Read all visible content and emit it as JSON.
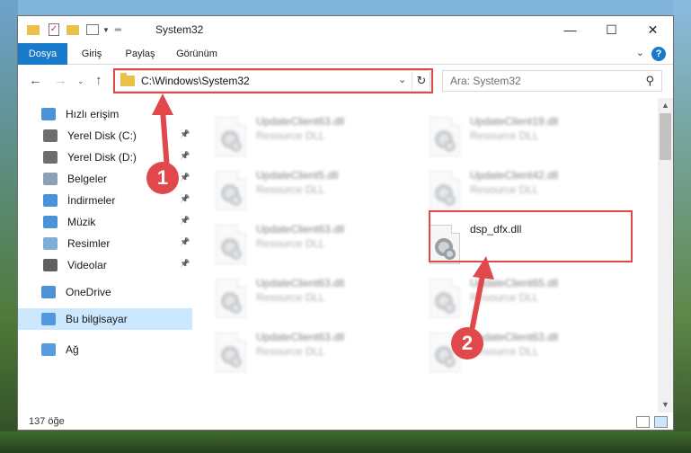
{
  "window": {
    "title": "System32"
  },
  "ribbon": {
    "tabs": [
      "Dosya",
      "Giriş",
      "Paylaş",
      "Görünüm"
    ],
    "help": "?"
  },
  "address": {
    "path": "C:\\Windows\\System32"
  },
  "search": {
    "placeholder": "Ara: System32"
  },
  "sidebar": {
    "items": [
      {
        "label": "Hızlı erişim",
        "icon": "star-icon",
        "pinned": false
      },
      {
        "label": "Yerel Disk (C:)",
        "icon": "drive-icon",
        "pinned": true
      },
      {
        "label": "Yerel Disk (D:)",
        "icon": "drive-icon",
        "pinned": true
      },
      {
        "label": "Belgeler",
        "icon": "documents-icon",
        "pinned": true
      },
      {
        "label": "İndirmeler",
        "icon": "download-icon",
        "pinned": true
      },
      {
        "label": "Müzik",
        "icon": "music-icon",
        "pinned": true
      },
      {
        "label": "Resimler",
        "icon": "pictures-icon",
        "pinned": true
      },
      {
        "label": "Videolar",
        "icon": "videos-icon",
        "pinned": true
      },
      {
        "label": "OneDrive",
        "icon": "cloud-icon",
        "pinned": false
      },
      {
        "label": "Bu bilgisayar",
        "icon": "computer-icon",
        "pinned": false,
        "selected": true
      },
      {
        "label": "Ağ",
        "icon": "network-icon",
        "pinned": false
      }
    ]
  },
  "files": [
    {
      "name": "UpdateClient63.dll",
      "desc": "Resource DLL",
      "blurred": true
    },
    {
      "name": "UpdateClient19.dll",
      "desc": "Resource DLL",
      "blurred": true
    },
    {
      "name": "UpdateClient5.dll",
      "desc": "Resource DLL",
      "blurred": true
    },
    {
      "name": "UpdateClient42.dll",
      "desc": "Resource DLL",
      "blurred": true
    },
    {
      "name": "UpdateClient63.dll",
      "desc": "Resource DLL",
      "blurred": true
    },
    {
      "name": "dsp_dfx.dll",
      "desc": "",
      "blurred": false
    },
    {
      "name": "UpdateClient63.dll",
      "desc": "Resource DLL",
      "blurred": true
    },
    {
      "name": "UpdateClient65.dll",
      "desc": "Resource DLL",
      "blurred": true
    },
    {
      "name": "UpdateClient63.dll",
      "desc": "Resource DLL",
      "blurred": true
    },
    {
      "name": "UpdateClient63.dll",
      "desc": "Resource DLL",
      "blurred": true
    }
  ],
  "status": {
    "count": "137 öğe"
  },
  "annotations": {
    "step1": "1",
    "step2": "2",
    "color": "#e0484c"
  }
}
